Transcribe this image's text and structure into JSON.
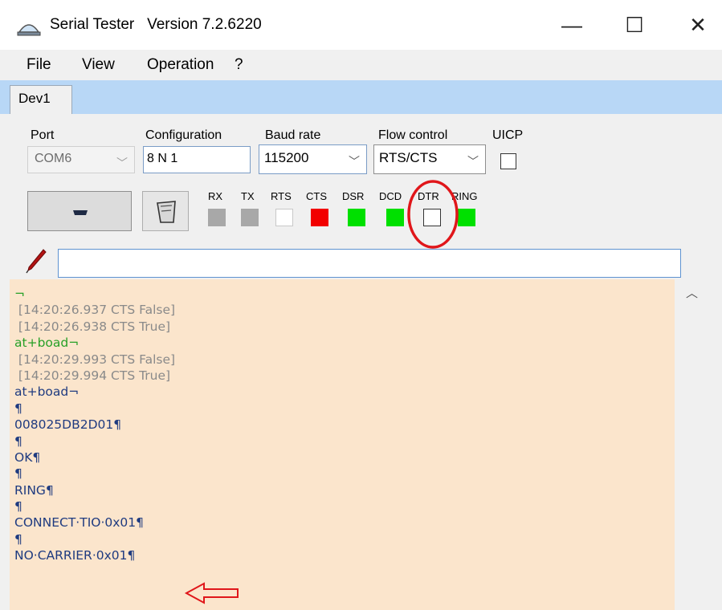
{
  "window": {
    "title": "Serial Tester   Version 7.2.6220",
    "controls": {
      "minimize": "—",
      "maximize": "☐",
      "close": "✕"
    }
  },
  "menu": [
    "File",
    "View",
    "Operation",
    "?"
  ],
  "tabs": [
    {
      "label": "Dev1",
      "active": true
    }
  ],
  "settings": {
    "port": {
      "label": "Port",
      "value": "COM6",
      "enabled": false
    },
    "configuration": {
      "label": "Configuration",
      "value": "8 N 1"
    },
    "baud_rate": {
      "label": "Baud rate",
      "value": "115200"
    },
    "flow_control": {
      "label": "Flow control",
      "value": "RTS/CTS"
    },
    "uicp": {
      "label": "UICP",
      "checked": false
    }
  },
  "signals": [
    {
      "name": "RX",
      "state": "inactive",
      "color": "#a8a8a8"
    },
    {
      "name": "TX",
      "state": "inactive",
      "color": "#a8a8a8"
    },
    {
      "name": "RTS",
      "state": "off",
      "color": "#ffffff"
    },
    {
      "name": "CTS",
      "state": "alert",
      "color": "#f20000"
    },
    {
      "name": "DSR",
      "state": "on",
      "color": "#00e000"
    },
    {
      "name": "DCD",
      "state": "on",
      "color": "#00e000"
    },
    {
      "name": "DTR",
      "state": "off",
      "color": "#ffffff"
    },
    {
      "name": "RING",
      "state": "on",
      "color": "#00e000"
    }
  ],
  "send": {
    "value": "",
    "icon": "pen-icon"
  },
  "log": [
    {
      "text": "¬",
      "kind": "sent"
    },
    {
      "text": " [14:20:26.937 CTS False]",
      "kind": "event"
    },
    {
      "text": " [14:20:26.938 CTS True]",
      "kind": "event"
    },
    {
      "text": "at+boad¬",
      "kind": "sent"
    },
    {
      "text": " [14:20:29.993 CTS False]",
      "kind": "event"
    },
    {
      "text": " [14:20:29.994 CTS True]",
      "kind": "event"
    },
    {
      "text": "at+boad¬",
      "kind": "recv"
    },
    {
      "text": "¶",
      "kind": "recv"
    },
    {
      "text": "008025DB2D01¶",
      "kind": "recv"
    },
    {
      "text": "¶",
      "kind": "recv"
    },
    {
      "text": "OK¶",
      "kind": "recv"
    },
    {
      "text": "¶",
      "kind": "recv"
    },
    {
      "text": "RING¶",
      "kind": "recv"
    },
    {
      "text": "¶",
      "kind": "recv"
    },
    {
      "text": "CONNECT·TIO·0x01¶",
      "kind": "recv"
    },
    {
      "text": "¶",
      "kind": "recv"
    },
    {
      "text": "NO·CARRIER·0x01¶",
      "kind": "recv"
    }
  ],
  "annotations": {
    "highlight_color": "#e0161a",
    "highlighted_signal": "DTR",
    "arrow_target": "NO·CARRIER·0x01¶"
  },
  "colors": {
    "tab_strip": "#b8d7f6",
    "log_background": "#fbe5cc",
    "sent_text": "#27a027",
    "event_text": "#8a8a8a",
    "received_text": "#1f3b80"
  }
}
